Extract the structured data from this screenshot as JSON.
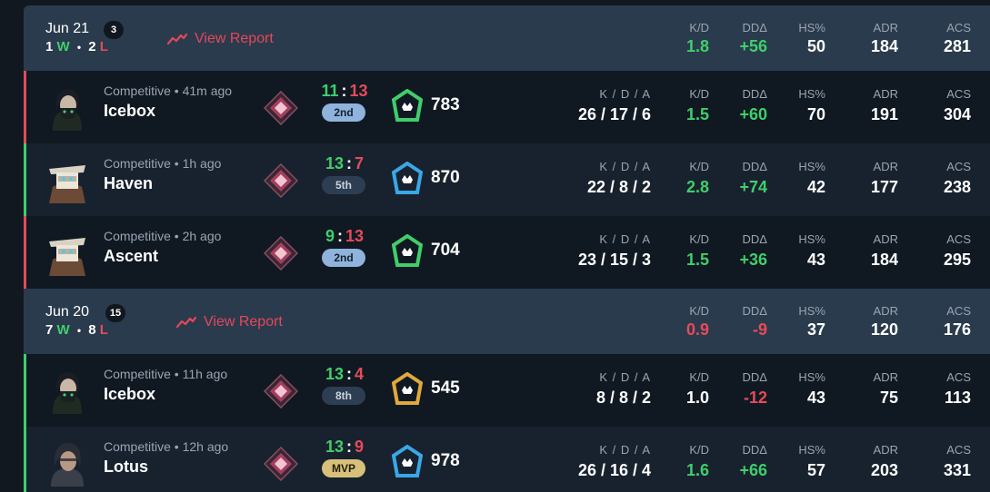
{
  "stat_labels": {
    "kda": "K / D / A",
    "kd": "K/D",
    "dd": "DDΔ",
    "hs": "HS%",
    "adr": "ADR",
    "acs": "ACS"
  },
  "groups": [
    {
      "date": "Jun 21",
      "count": "3",
      "wins": "1",
      "w_letter": "W",
      "losses": "2",
      "l_letter": "L",
      "sep": "•",
      "report_label": "View Report",
      "kd": "1.8",
      "dd": "+56",
      "hs": "50",
      "adr": "184",
      "acs": "281",
      "kd_color": "green",
      "dd_color": "green",
      "matches": [
        {
          "result": "loss",
          "agent": "viper",
          "mode": "Competitive • 41m ago",
          "map": "Icebox",
          "score_us": "11",
          "score_colon": ":",
          "score_them": "13",
          "us_color": "green",
          "them_color": "red",
          "place": "2nd",
          "place_style": "top",
          "rank_color": "#3fcf6b",
          "rr": "783",
          "kda": "26 / 17 / 6",
          "kd": "1.5",
          "dd": "+60",
          "hs": "70",
          "adr": "191",
          "acs": "304",
          "kd_color": "green",
          "dd_color": "green"
        },
        {
          "result": "win",
          "agent": "cypher",
          "mode": "Competitive • 1h ago",
          "map": "Haven",
          "score_us": "13",
          "score_colon": ":",
          "score_them": "7",
          "us_color": "green",
          "them_color": "red",
          "place": "5th",
          "place_style": "mid",
          "rank_color": "#3aa7e6",
          "rr": "870",
          "kda": "22 / 8 / 2",
          "kd": "2.8",
          "dd": "+74",
          "hs": "42",
          "adr": "177",
          "acs": "238",
          "kd_color": "green",
          "dd_color": "green"
        },
        {
          "result": "loss",
          "agent": "cypher",
          "mode": "Competitive • 2h ago",
          "map": "Ascent",
          "score_us": "9",
          "score_colon": ":",
          "score_them": "13",
          "us_color": "green",
          "them_color": "red",
          "place": "2nd",
          "place_style": "top",
          "rank_color": "#3fcf6b",
          "rr": "704",
          "kda": "23 / 15 / 3",
          "kd": "1.5",
          "dd": "+36",
          "hs": "43",
          "adr": "184",
          "acs": "295",
          "kd_color": "green",
          "dd_color": "green"
        }
      ]
    },
    {
      "date": "Jun 20",
      "count": "15",
      "wins": "7",
      "w_letter": "W",
      "losses": "8",
      "l_letter": "L",
      "sep": "•",
      "report_label": "View Report",
      "kd": "0.9",
      "dd": "-9",
      "hs": "37",
      "adr": "120",
      "acs": "176",
      "kd_color": "red",
      "dd_color": "red",
      "matches": [
        {
          "result": "win",
          "agent": "viper",
          "mode": "Competitive • 11h ago",
          "map": "Icebox",
          "score_us": "13",
          "score_colon": ":",
          "score_them": "4",
          "us_color": "green",
          "them_color": "red",
          "place": "8th",
          "place_style": "mid",
          "rank_color": "#e0a93a",
          "rr": "545",
          "kda": "8 / 8 / 2",
          "kd": "1.0",
          "dd": "-12",
          "hs": "43",
          "adr": "75",
          "acs": "113",
          "kd_color": "white",
          "dd_color": "red"
        },
        {
          "result": "win",
          "agent": "fade",
          "mode": "Competitive • 12h ago",
          "map": "Lotus",
          "score_us": "13",
          "score_colon": ":",
          "score_them": "9",
          "us_color": "green",
          "them_color": "red",
          "place": "MVP",
          "place_style": "mvp",
          "rank_color": "#3aa7e6",
          "rr": "978",
          "kda": "26 / 16 / 4",
          "kd": "1.6",
          "dd": "+66",
          "hs": "57",
          "adr": "203",
          "acs": "331",
          "kd_color": "green",
          "dd_color": "green"
        }
      ]
    }
  ]
}
